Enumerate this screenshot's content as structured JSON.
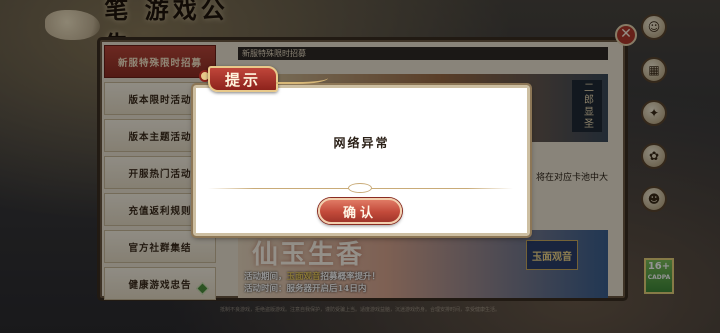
{
  "background": {
    "title": "笔 游戏公告",
    "tabs": [
      {
        "label": "新服特殊限时招募",
        "active": true
      },
      {
        "label": "版本限时活动",
        "active": false
      },
      {
        "label": "版本主题活动",
        "active": false
      },
      {
        "label": "开服热门活动",
        "active": false
      },
      {
        "label": "充值返利规则",
        "active": false
      },
      {
        "label": "官方社群集结",
        "active": false
      },
      {
        "label": "健康游戏忠告",
        "active": false,
        "new_badge": true
      }
    ],
    "content_header": "新服特殊限时招募",
    "banner_top_label": "二郎显圣",
    "mid_text": "将在对应卡池中大",
    "banner_bottom": {
      "title": "仙玉生香",
      "badge": "玉面观音",
      "line1_prefix": "活动期间，",
      "line1_highlight": "玉面观音",
      "line1_suffix": "招募概率提升！",
      "line2": "活动时间：服务器开启后14日内"
    },
    "age_rating": "16+",
    "age_rating_sub": "CADPA",
    "footer": "抵制不良游戏，拒绝盗版游戏。注意自我保护，谨防受骗上当。适度游戏益脑，沉迷游戏伤身。合理安排时间，享受健康生活。"
  },
  "dialog": {
    "title": "提示",
    "message": "网络异常",
    "confirm_label": "确认"
  },
  "colors": {
    "accent_red": "#b23a2c",
    "button_red": "#c24a3a",
    "gold_border": "#cdbfa2"
  },
  "icons": [
    "close-icon",
    "avatar-icon",
    "calendar-icon",
    "gift-icon",
    "settings-icon",
    "face-icon"
  ]
}
